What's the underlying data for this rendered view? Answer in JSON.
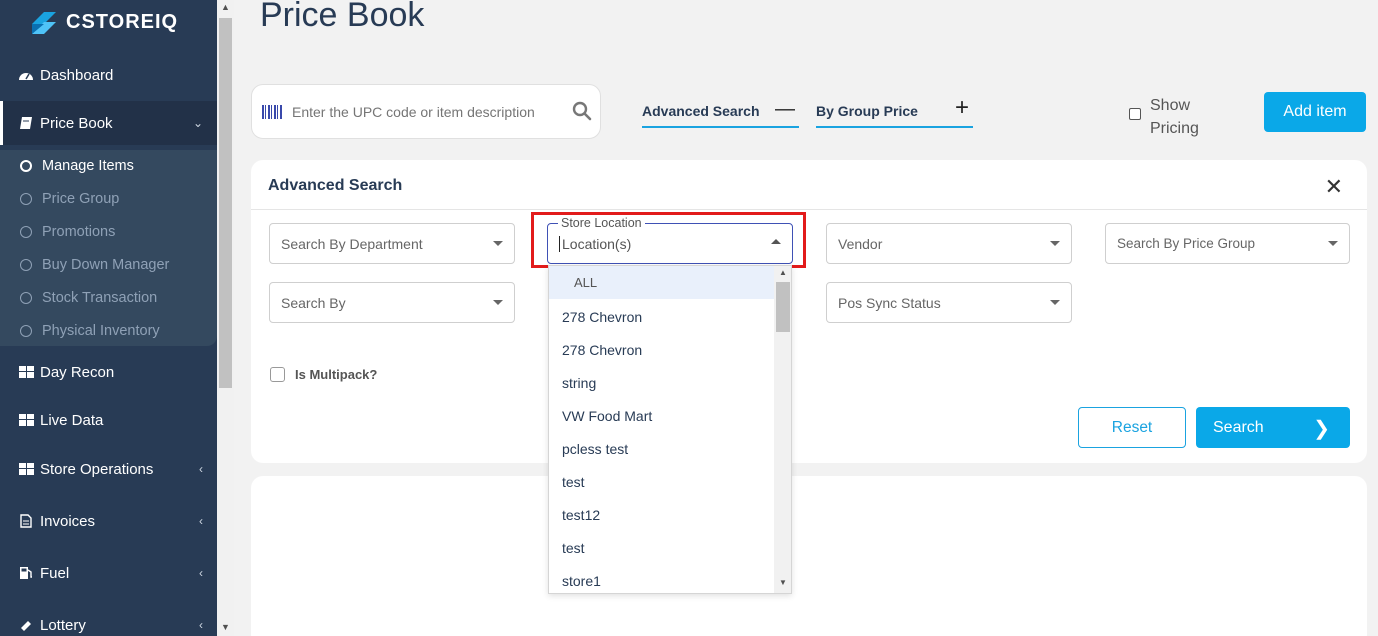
{
  "app": {
    "name": "CSTOREIQ"
  },
  "sidebar": {
    "items": [
      {
        "label": "Dashboard",
        "icon": "dashboard-icon"
      },
      {
        "label": "Price Book",
        "icon": "book-icon"
      },
      {
        "label": "Day Recon",
        "icon": "grid-icon"
      },
      {
        "label": "Live Data",
        "icon": "grid-icon"
      },
      {
        "label": "Store Operations",
        "icon": "grid-icon"
      },
      {
        "label": "Invoices",
        "icon": "file-icon"
      },
      {
        "label": "Fuel",
        "icon": "fuel-icon"
      },
      {
        "label": "Lottery",
        "icon": "ticket-icon"
      }
    ],
    "subitems": [
      {
        "label": "Manage Items"
      },
      {
        "label": "Price Group"
      },
      {
        "label": "Promotions"
      },
      {
        "label": "Buy Down Manager"
      },
      {
        "label": "Stock Transaction"
      },
      {
        "label": "Physical Inventory"
      }
    ]
  },
  "page": {
    "title": "Price Book"
  },
  "toolbar": {
    "search_placeholder": "Enter the UPC code or item description",
    "advanced_search": "Advanced Search",
    "advanced_symbol": "—",
    "by_group_price": "By Group Price",
    "group_symbol": "+",
    "show_pricing": "Show Pricing",
    "add_item": "Add item"
  },
  "advanced_panel": {
    "title": "Advanced Search",
    "close": "✕",
    "fields": {
      "department": "Search By Department",
      "store_location_label": "Store Location",
      "store_location_value": "Location(s)",
      "vendor": "Vendor",
      "price_group": "Search By Price Group",
      "search_by": "Search By",
      "pos_sync": "Pos Sync Status"
    },
    "multipack": "Is Multipack?",
    "reset": "Reset",
    "search": "Search",
    "search_arrow": "❯"
  },
  "location_dropdown": {
    "options": [
      "ALL",
      "278 Chevron",
      "278 Chevron",
      "string",
      "VW Food Mart",
      "pcless test",
      "test",
      "test12",
      "test",
      "store1"
    ]
  },
  "colors": {
    "sidebar": "#283b55",
    "accent": "#0aa8e8",
    "highlight": "#e21b1b"
  }
}
